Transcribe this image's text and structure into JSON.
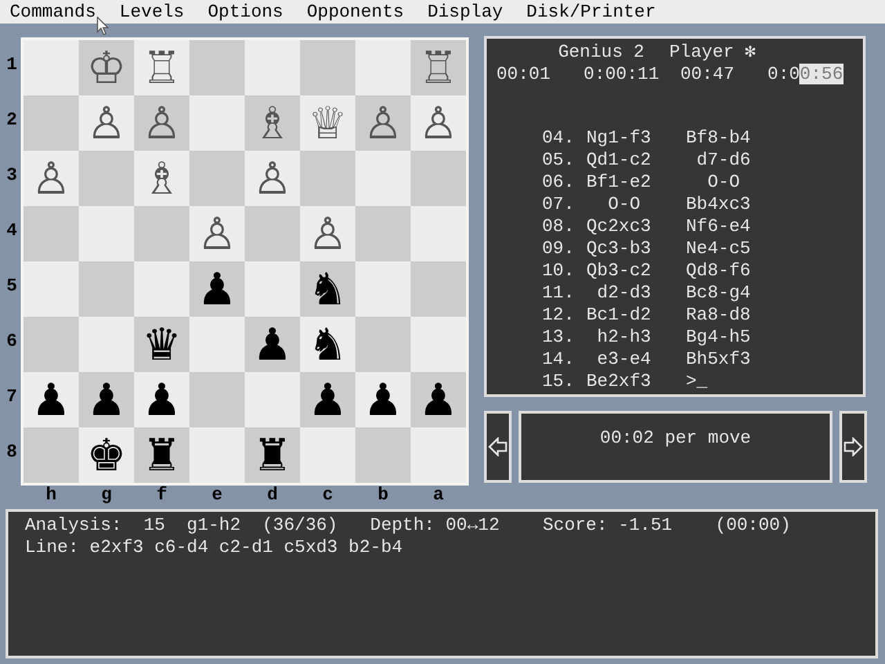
{
  "menu": [
    "Commands",
    "Levels",
    "Options",
    "Opponents",
    "Display",
    "Disk/Printer"
  ],
  "board": {
    "ranks": [
      {
        "label": "1",
        "squares": [
          {
            "kind": "empty"
          },
          {
            "kind": "piece",
            "piece": "♔"
          },
          {
            "kind": "piece",
            "piece": "♖"
          },
          {
            "kind": "empty"
          },
          {
            "kind": "empty"
          },
          {
            "kind": "empty"
          },
          {
            "kind": "empty"
          },
          {
            "kind": "piece",
            "piece": "♖"
          }
        ]
      },
      {
        "label": "2",
        "squares": [
          {
            "kind": "empty"
          },
          {
            "kind": "piece",
            "piece": "♙"
          },
          {
            "kind": "piece",
            "piece": "♙"
          },
          {
            "kind": "empty"
          },
          {
            "kind": "piece",
            "piece": "♗"
          },
          {
            "kind": "piece",
            "piece": "♕"
          },
          {
            "kind": "piece",
            "piece": "♙"
          },
          {
            "kind": "piece",
            "piece": "♙"
          }
        ]
      },
      {
        "label": "3",
        "squares": [
          {
            "kind": "piece",
            "piece": "♙"
          },
          {
            "kind": "empty"
          },
          {
            "kind": "piece",
            "piece": "♗"
          },
          {
            "kind": "empty"
          },
          {
            "kind": "piece",
            "piece": "♙"
          },
          {
            "kind": "empty"
          },
          {
            "kind": "empty"
          },
          {
            "kind": "empty"
          }
        ]
      },
      {
        "label": "4",
        "squares": [
          {
            "kind": "empty"
          },
          {
            "kind": "empty"
          },
          {
            "kind": "empty"
          },
          {
            "kind": "piece",
            "piece": "♙"
          },
          {
            "kind": "empty"
          },
          {
            "kind": "piece",
            "piece": "♙"
          },
          {
            "kind": "empty"
          },
          {
            "kind": "empty"
          }
        ]
      },
      {
        "label": "5",
        "squares": [
          {
            "kind": "empty"
          },
          {
            "kind": "empty"
          },
          {
            "kind": "empty"
          },
          {
            "kind": "piece",
            "piece": "♟"
          },
          {
            "kind": "empty"
          },
          {
            "kind": "piece",
            "piece": "♞"
          },
          {
            "kind": "empty"
          },
          {
            "kind": "empty"
          }
        ]
      },
      {
        "label": "6",
        "squares": [
          {
            "kind": "empty"
          },
          {
            "kind": "empty"
          },
          {
            "kind": "piece",
            "piece": "♛"
          },
          {
            "kind": "empty"
          },
          {
            "kind": "piece",
            "piece": "♟"
          },
          {
            "kind": "piece",
            "piece": "♞"
          },
          {
            "kind": "empty"
          },
          {
            "kind": "empty"
          }
        ]
      },
      {
        "label": "7",
        "squares": [
          {
            "kind": "piece",
            "piece": "♟"
          },
          {
            "kind": "piece",
            "piece": "♟"
          },
          {
            "kind": "piece",
            "piece": "♟"
          },
          {
            "kind": "empty"
          },
          {
            "kind": "empty"
          },
          {
            "kind": "piece",
            "piece": "♟"
          },
          {
            "kind": "piece",
            "piece": "♟"
          },
          {
            "kind": "piece",
            "piece": "♟"
          }
        ]
      },
      {
        "label": "8",
        "squares": [
          {
            "kind": "empty"
          },
          {
            "kind": "piece",
            "piece": "♚"
          },
          {
            "kind": "piece",
            "piece": "♜"
          },
          {
            "kind": "empty"
          },
          {
            "kind": "piece",
            "piece": "♜"
          },
          {
            "kind": "empty"
          },
          {
            "kind": "empty"
          },
          {
            "kind": "empty"
          }
        ]
      }
    ],
    "files": [
      "h",
      "g",
      "f",
      "e",
      "d",
      "c",
      "b",
      "a"
    ]
  },
  "players": [
    {
      "name": "Genius 2",
      "move_time": "00:01",
      "total_time": "0:00:11"
    },
    {
      "name": "Player ✻",
      "move_time": "00:47",
      "total_time": "0:00:56",
      "cursor": true
    }
  ],
  "moves": [
    {
      "number": "04.",
      "white": "Ng1-f3",
      "black": "Bf8-b4"
    },
    {
      "number": "05.",
      "white": "Qd1-c2",
      "black": " d7-d6"
    },
    {
      "number": "06.",
      "white": "Bf1-e2",
      "black": "  O-O"
    },
    {
      "number": "07.",
      "white": "  O-O",
      "black": "Bb4xc3"
    },
    {
      "number": "08.",
      "white": "Qc2xc3",
      "black": "Nf6-e4"
    },
    {
      "number": "09.",
      "white": "Qc3-b3",
      "black": "Ne4-c5"
    },
    {
      "number": "10.",
      "white": "Qb3-c2",
      "black": "Qd8-f6"
    },
    {
      "number": "11.",
      "white": " d2-d3",
      "black": "Bc8-g4"
    },
    {
      "number": "12.",
      "white": "Bc1-d2",
      "black": "Ra8-d8"
    },
    {
      "number": "13.",
      "white": " h2-h3",
      "black": "Bg4-h5"
    },
    {
      "number": "14.",
      "white": " e3-e4",
      "black": "Bh5xf3"
    },
    {
      "number": "15.",
      "white": "Be2xf3",
      "black": ">_"
    }
  ],
  "level_display": "00:02 per move",
  "analysis": {
    "line1": "Analysis:  15  g1-h2  (36/36)   Depth: 00↔12    Score: -1.51    (00:00)",
    "line2": "Line: e2xf3 c6-d4 c2-d1 c5xd3 b2-b4"
  }
}
